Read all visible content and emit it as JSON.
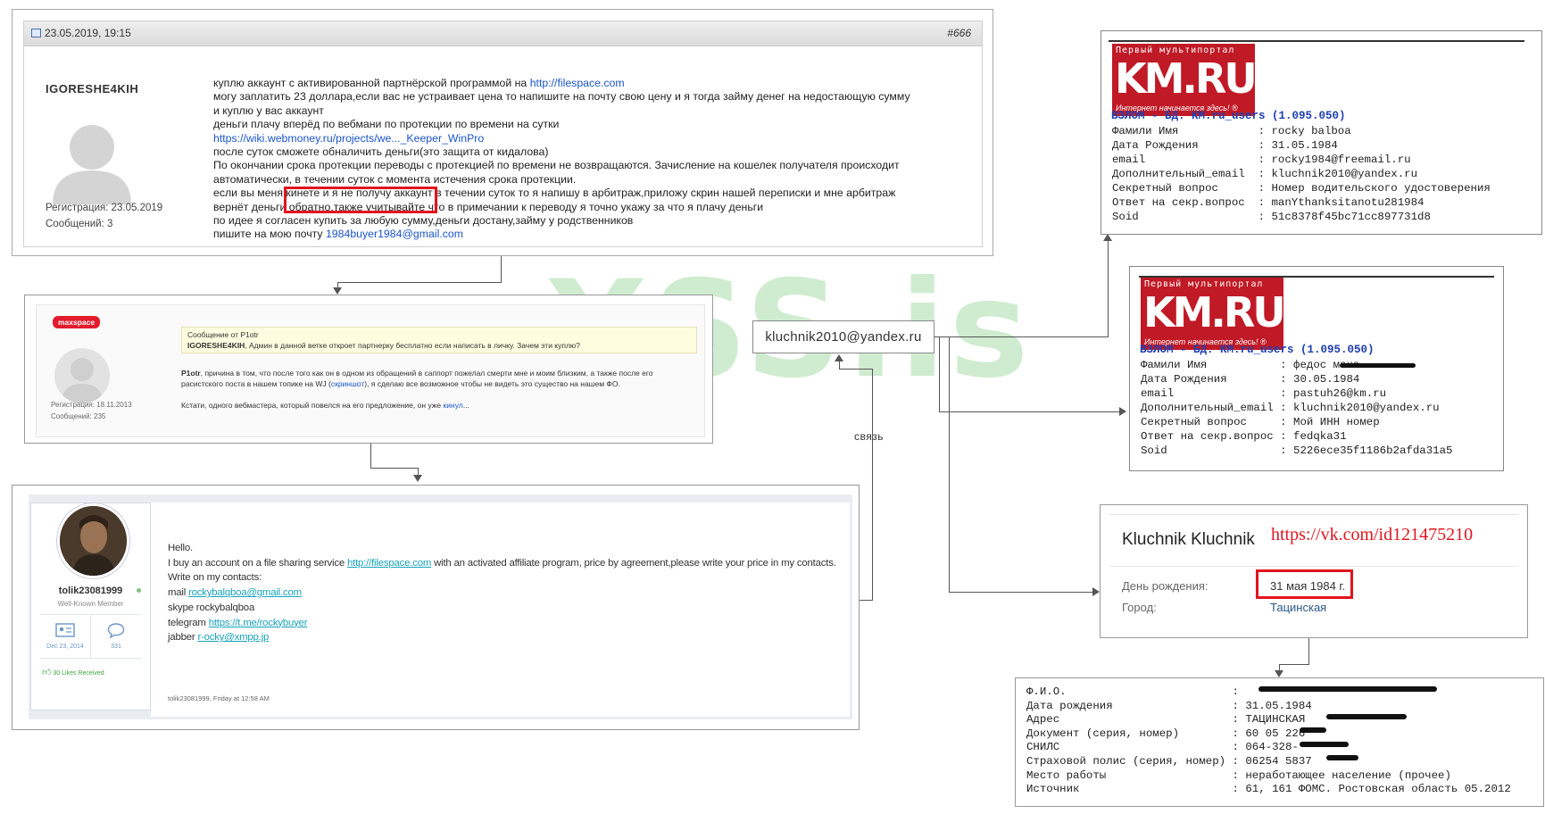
{
  "watermark": "XSS.is",
  "post1": {
    "date": "23.05.2019, 19:15",
    "post_number": "#666",
    "username": "IGORESHE4KIH",
    "registration": "Регистрация: 23.05.2019",
    "messages": "Сообщений: 3",
    "lines": [
      {
        "text": "куплю аккаунт с активированной партнёрской программой на ",
        "link": "http://filespace.com"
      },
      {
        "text": "могу заплатить 23 доллара,если вас не устраивает цена то напишите на почту свою цену и я тогда займу денег на недостающую сумму"
      },
      {
        "text": "и куплю у вас аккаунт"
      },
      {
        "text": "деньги плачу вперёд по вебмани по протекции по времени на сутки"
      },
      {
        "text": "",
        "link": "https://wiki.webmoney.ru/projects/we..._Keeper_WinPro"
      },
      {
        "text": "после суток сможете обналичить деньги(это защита от кидалова)"
      },
      {
        "text": "По окончании срока протекции переводы с протекцией по времени не возвращаются. Зачисление на кошелек получателя происходит"
      },
      {
        "text": "автоматически, в течении суток с момента истечения срока протекции."
      },
      {
        "text": "если вы меня кинете и я не получу аккаунт в течении суток то я напишу в арбитраж,приложу скрин нашей переписки и мне арбитраж"
      },
      {
        "text": "вернёт деньги обратно,также учитывайте что в примечании к переводу я точно укажу за что я плачу деньги"
      },
      {
        "text": "по идее я согласен купить за любую сумму,деньги достану,займу у родственников"
      },
      {
        "text": "пишите на мою почту ",
        "link": "1984buyer1984@gmail.com"
      }
    ]
  },
  "post2": {
    "badge": "maxspace",
    "quote_header": "Сообщение от P1otr",
    "quote_user": "IGORESHE4KIH",
    "quote_text": ", Админ в данной ветке откроет партнерку бесплатно если написать в личку. Зачем эти куплю?",
    "body_user": "P1otr",
    "body_line1": ", причина в том, что после того как он в одном из обращений в саппорт пожелал смерти мне и моим близким, а также после его",
    "body_line2a": "расистского поста в нашем топике на WJ (",
    "body_link1": "скриншот",
    "body_line2b": "), я сделаю все возможное чтобы не видеть это существо на нашем ФО.",
    "body_line3": "Кстати, одного вебмастера, который повелся на его предложение, он уже ",
    "body_link2": "кинул",
    "body_line3_end": "...",
    "registration": "Регистрация: 18.11.2013",
    "messages": "Сообщений: 235"
  },
  "post3": {
    "username": "tolik23081999",
    "rank": "Well-Known Member",
    "stat_date": "Dec 23, 2014",
    "stat_count": "331",
    "likes": "30 Likes Received",
    "line1": "Hello.",
    "line2a": "I buy an account on a file sharing service ",
    "line2_link": "http://filespace.com",
    "line2b": " with an activated affiliate program, price by agreement,please write your price in my contacts.",
    "line3": "Write on my contacts:",
    "mail_label": "mail ",
    "mail_link": "rockybalqboa@gmail.com",
    "skype": "skype rockybalqboa",
    "telegram_label": "telegram ",
    "telegram_link": "https://t.me/rockybuyer",
    "jabber_label": "jabber ",
    "jabber_link": "r-ocky@xmpp.jp",
    "footer": "tolik23081999, Friday at 12:58 AM"
  },
  "email_center": "kluchnik2010@yandex.ru",
  "svyaz": "связь",
  "km_logo": {
    "top": "Первый мультипортал",
    "main": "KM.RU",
    "bottom": "Интернет начинается здесь! ®"
  },
  "km1": {
    "title": "ВЗЛОМ - БД. KM.ru_users (1.095.050)",
    "rows": [
      {
        "k": "Фамили Имя",
        "v": "rocky balboa"
      },
      {
        "k": "Дата Рождения",
        "v": "31.05.1984"
      },
      {
        "k": "email",
        "v": "rocky1984@freemail.ru"
      },
      {
        "k": "Дополнительный_email",
        "v": "kluchnik2010@yandex.ru"
      },
      {
        "k": "Секретный вопрос",
        "v": "Номер водительского удостоверения"
      },
      {
        "k": "Ответ на секр.вопрос",
        "v": "manYthanksitanotu281984"
      },
      {
        "k": "Soid",
        "v": "51c8378f45bc71cc897731d8"
      }
    ]
  },
  "km2": {
    "title": "ВЗЛОМ - БД. KM.ru_users (1.095.050)",
    "rows": [
      {
        "k": "Фамили Имя",
        "v": "федос мака"
      },
      {
        "k": "Дата Рождения",
        "v": "30.05.1984"
      },
      {
        "k": "email",
        "v": "pastuh26@km.ru"
      },
      {
        "k": "Дополнительный_email",
        "v": "kluchnik2010@yandex.ru"
      },
      {
        "k": "Секретный вопрос",
        "v": "Мой ИНН номер"
      },
      {
        "k": "Ответ на секр.вопрос",
        "v": "fedqka31"
      },
      {
        "k": "Soid",
        "v": "5226ece35f1186b2afda31a5"
      }
    ]
  },
  "vk": {
    "name": "Kluchnik Kluchnik",
    "url": "https://vk.com/id121475210",
    "birthday_label": "День рождения:",
    "birthday_value": "31 мая 1984 г.",
    "city_label": "Город:",
    "city_value": "Тацинская"
  },
  "fio": {
    "rows": [
      {
        "k": "Ф.И.О.",
        "v": ""
      },
      {
        "k": "Дата рождения",
        "v": "31.05.1984"
      },
      {
        "k": "Адрес",
        "v": "ТАЦИНСКАЯ"
      },
      {
        "k": "Документ (серия, номер)",
        "v": "60 05 226"
      },
      {
        "k": "СНИЛС",
        "v": "064-328-"
      },
      {
        "k": "Страховой полис (серия, номер)",
        "v": "06254 5837"
      },
      {
        "k": "Место работы",
        "v": "неработающее население (прочее)"
      },
      {
        "k": "Источник",
        "v": "61, 161 ФОМС. Ростовская область 05.2012"
      }
    ]
  },
  "colors": {
    "highlight_red": "#e0141e",
    "link_blue": "#1a55c8",
    "km_red": "#c01a26",
    "km_title_blue": "#1e3fb4",
    "teal_link": "#17a2b8",
    "watermark_green": "#78c878"
  }
}
